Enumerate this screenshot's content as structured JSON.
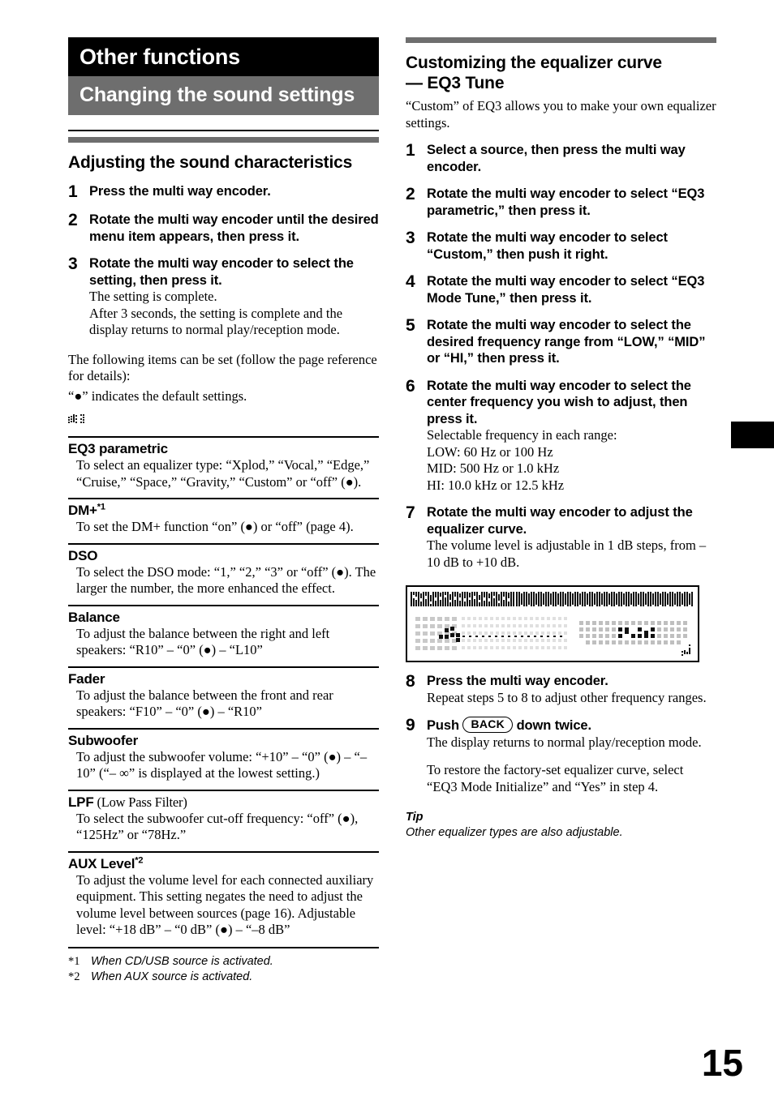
{
  "page": {
    "number": "15",
    "thumb_tab": {
      "name": "chapter-thumb-tab",
      "color": "#000000"
    }
  },
  "left_column": {
    "chapter_banner": "Other functions",
    "section_banner": "Changing the sound settings",
    "heading": "Adjusting the sound characteristics",
    "steps": [
      {
        "num": "1",
        "title": "Press the multi way encoder.",
        "desc": []
      },
      {
        "num": "2",
        "title": "Rotate the multi way encoder until the desired menu item appears, then press it.",
        "desc": []
      },
      {
        "num": "3",
        "title": "Rotate the multi way encoder to select the setting, then press it.",
        "desc": [
          "The setting is complete.",
          "After 3 seconds, the setting is complete and the display returns to normal play/reception mode."
        ]
      }
    ],
    "intro_paragraphs": [
      "The following items can be set (follow the page reference for details):",
      "“●” indicates the default settings."
    ],
    "dot_glyph_name": "lcd-dot-matrix-glyph",
    "settings": [
      {
        "name": "EQ3 parametric",
        "suffix": "",
        "footnote": "",
        "desc": "To select an equalizer type: “Xplod,” “Vocal,” “Edge,” “Cruise,” “Space,” “Gravity,” “Custom” or “off” (●)."
      },
      {
        "name": "DM+",
        "suffix": "",
        "footnote": "*1",
        "desc": "To set the DM+ function “on” (●) or “off” (page 4)."
      },
      {
        "name": "DSO",
        "suffix": "",
        "footnote": "",
        "desc": "To select the DSO mode: “1,” “2,” “3” or “off” (●). The larger the number, the more enhanced the effect."
      },
      {
        "name": "Balance",
        "suffix": "",
        "footnote": "",
        "desc": "To adjust the balance between the right and left speakers: “R10” – “0” (●) – “L10”"
      },
      {
        "name": "Fader",
        "suffix": "",
        "footnote": "",
        "desc": "To adjust the balance between the front and rear speakers: “F10” – “0” (●) – “R10”"
      },
      {
        "name": "Subwoofer",
        "suffix": "",
        "footnote": "",
        "desc": "To adjust the subwoofer volume: “+10” – “0” (●) – “–10” (“– ∞” is displayed at the lowest setting.)"
      },
      {
        "name": "LPF",
        "suffix": " (Low Pass Filter)",
        "footnote": "",
        "desc": "To select the subwoofer cut-off frequency: “off” (●), “125Hz” or “78Hz.”"
      },
      {
        "name": "AUX Level",
        "suffix": "",
        "footnote": "*2",
        "desc": "To adjust the volume level for each connected auxiliary equipment. This setting negates the need to adjust the volume level between sources (page 16). Adjustable level: “+18 dB” – “0 dB” (●) – “–8 dB”"
      }
    ],
    "footnotes": [
      {
        "mark": "*1",
        "text": "When CD/USB source is activated."
      },
      {
        "mark": "*2",
        "text": "When AUX source is activated."
      }
    ]
  },
  "right_column": {
    "heading_line1": "Customizing the equalizer curve",
    "heading_line2": "— EQ3 Tune",
    "intro": "“Custom” of EQ3 allows you to make your own equalizer settings.",
    "steps": [
      {
        "num": "1",
        "title": "Select a source, then press the multi way encoder.",
        "desc": []
      },
      {
        "num": "2",
        "title": "Rotate the multi way encoder to select “EQ3 parametric,” then press it.",
        "desc": []
      },
      {
        "num": "3",
        "title": "Rotate the multi way encoder to select “Custom,” then push it right.",
        "desc": []
      },
      {
        "num": "4",
        "title": "Rotate the multi way encoder to select “EQ3 Mode Tune,” then press it.",
        "desc": []
      },
      {
        "num": "5",
        "title": "Rotate the multi way encoder to select the desired frequency range from “LOW,” “MID” or “HI,” then press it.",
        "desc": []
      },
      {
        "num": "6",
        "title": "Rotate the multi way encoder to select the center frequency you wish to adjust, then press it.",
        "desc": [
          "Selectable frequency in each range:",
          "LOW: 60 Hz or 100 Hz",
          "MID: 500 Hz or 1.0 kHz",
          "HI: 10.0 kHz or 12.5 kHz"
        ]
      },
      {
        "num": "7",
        "title": "Rotate the multi way encoder to adjust the equalizer curve.",
        "desc": [
          "The volume level is adjustable in 1 dB steps, from –10 dB to +10 dB."
        ]
      }
    ],
    "figure": {
      "name": "lcd-display-illustration",
      "caption": ""
    },
    "steps_after_figure": [
      {
        "num": "8",
        "title": "Press the multi way encoder.",
        "desc": [
          "Repeat steps 5 to 8 to adjust other frequency ranges."
        ]
      },
      {
        "num": "9",
        "title_before_key": "Push ",
        "key_label": "BACK",
        "title_after_key": " down twice.",
        "desc": [
          "The display returns to normal play/reception mode."
        ],
        "desc_gap": [
          "To restore the factory-set equalizer curve, select “EQ3 Mode Initialize” and “Yes” in step 4."
        ]
      }
    ],
    "tip_label": "Tip",
    "tip_text": "Other equalizer types are also adjustable."
  }
}
